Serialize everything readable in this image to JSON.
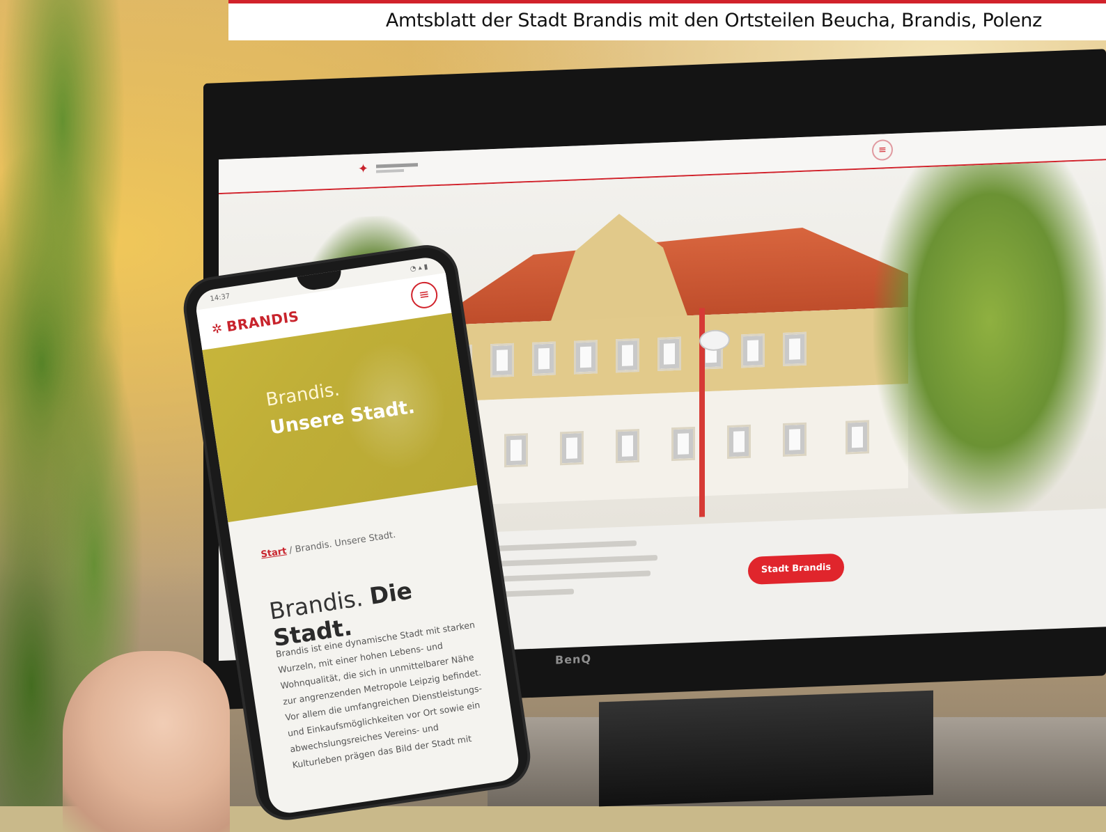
{
  "header": {
    "text": "Amtsblatt der Stadt Brandis mit den Ortsteilen Beucha, Brandis, Polenz",
    "accent_color": "#d1222b"
  },
  "monitor": {
    "brand": "BenQ",
    "website": {
      "cta_label": "Stadt Brandis",
      "menu_icon": "circle-menu-icon",
      "accent_color": "#e0252c"
    }
  },
  "phone": {
    "status_time": "14:37",
    "status_icons": "◔ ▴ ▮",
    "logo": {
      "mark": "✲",
      "text": "BRANDIS",
      "color": "#c8232c"
    },
    "menu_icon": "hamburger-menu-icon",
    "hero": {
      "line1": "Brandis.",
      "line2": "Unsere Stadt.",
      "color": "#c2b13a"
    },
    "breadcrumb": {
      "start": "Start",
      "separator": " / ",
      "current": "Brandis. Unsere Stadt."
    },
    "title": {
      "light": "Brandis.",
      "bold": "Die Stadt."
    },
    "body_lines": [
      "Brandis ist eine dynamische Stadt mit starken",
      "Wurzeln, mit einer hohen Lebens- und",
      "Wohnqualität, die sich in unmittelbarer Nähe",
      "zur angrenzenden Metropole Leipzig befindet.",
      "Vor allem die umfangreichen Dienstleistungs-",
      "und Einkaufsmöglichkeiten vor Ort sowie ein",
      "abwechslungsreiches Vereins- und",
      "Kulturleben prägen das Bild der Stadt mit"
    ]
  }
}
